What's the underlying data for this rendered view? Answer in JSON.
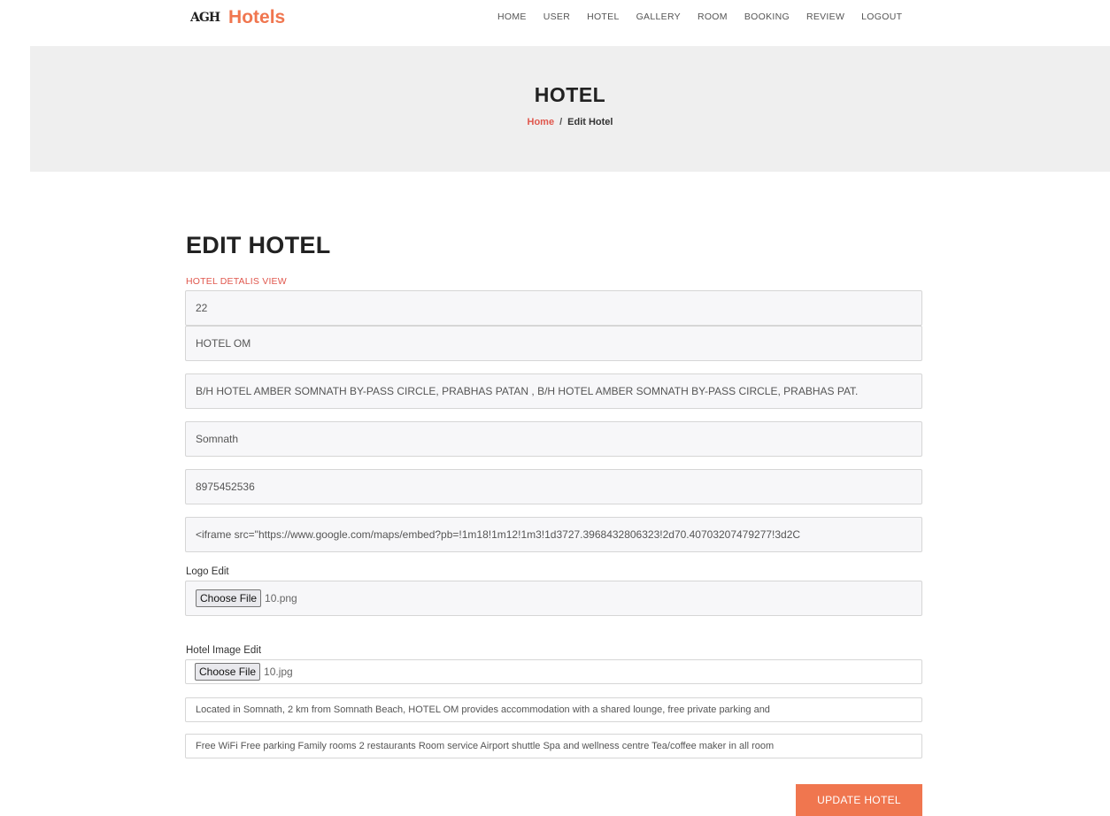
{
  "brand": {
    "mark": "AGH",
    "name": "Hotels"
  },
  "nav": [
    "HOME",
    "USER",
    "HOTEL",
    "GALLERY",
    "ROOM",
    "BOOKING",
    "REVIEW",
    "LOGOUT"
  ],
  "banner": {
    "title": "HOTEL",
    "breadcrumb_home": "Home",
    "breadcrumb_sep": "/",
    "breadcrumb_current": "Edit Hotel"
  },
  "form": {
    "title": "EDIT HOTEL",
    "section_label": "HOTEL DETALIS VIEW",
    "hotel_id": "22",
    "hotel_name": "HOTEL OM",
    "address": "B/H HOTEL AMBER SOMNATH BY-PASS CIRCLE, PRABHAS PATAN , B/H HOTEL AMBER SOMNATH BY-PASS CIRCLE, PRABHAS PAT.",
    "city": "Somnath",
    "phone": "8975452536",
    "map_embed": "<iframe src=\"https://www.google.com/maps/embed?pb=!1m18!1m12!1m3!1d3727.3968432806323!2d70.40703207479277!3d2C",
    "logo_label": "Logo Edit",
    "logo_button": "Choose File",
    "logo_file": "10.png",
    "image_label": "Hotel Image Edit",
    "image_button": "Choose File",
    "image_file": "10.jpg",
    "description": "Located in Somnath, 2 km from Somnath Beach, HOTEL OM provides accommodation with a shared lounge, free private parking and",
    "facilities": "Free WiFi Free parking Family rooms 2 restaurants Room service Airport shuttle Spa and wellness centre Tea/coffee maker in all room",
    "submit_label": "UPDATE HOTEL"
  },
  "colors": {
    "accent": "#f0764f",
    "crumb": "#e0574d",
    "banner_bg": "#efefef"
  }
}
